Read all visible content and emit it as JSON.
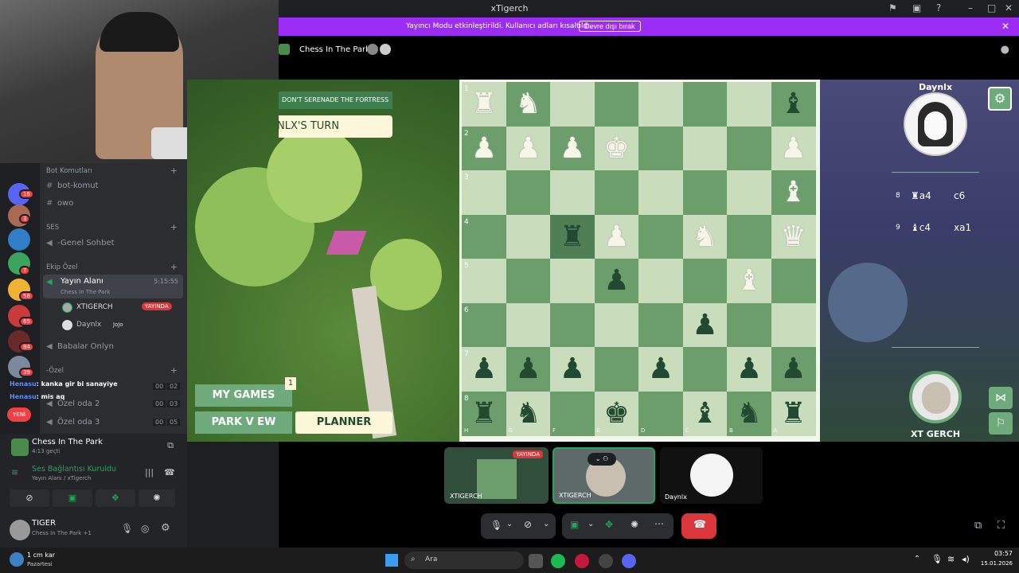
{
  "window": {
    "title": "xTigerch"
  },
  "banner": {
    "text": "Yayıncı Modu etkinleştirildi. Kullanıcı adları kısaltıldı.",
    "button": "Devre dışı bırak"
  },
  "activity": {
    "name": "Chess In The Park"
  },
  "channels": {
    "bot_category": "Bot Komutları",
    "bot_komut": "bot-komut",
    "owo": "owo",
    "ses_category": "SES",
    "genel": "-Genel Sohbet",
    "ekip_category": "Ekip Özel",
    "yayin_alani": "Yayın Alanı",
    "yayin_time": "5:15:55",
    "yayin_activity": "Chess In The Park",
    "user1": "XTIGERCH",
    "user1_badge": "YAYINDA",
    "user2": "Daynlx",
    "user2_status": "JoJo",
    "babalar": "Babalar Onlyn",
    "ozel_category": "-Özel",
    "chat1_user": "Henasu",
    "chat1_msg": ": kanka gir bi sanayiye",
    "chat2_user": "Henasu",
    "chat2_msg": ": mis aq",
    "ozel2": "Özel oda 2",
    "ozel2_a": "00",
    "ozel2_b": "03",
    "ozel3": "Özel oda 3",
    "ozel3_a": "00",
    "ozel3_b": "05",
    "ozel1_a": "00",
    "ozel1_b": "02",
    "yeni": "YENİ"
  },
  "guild_badges": [
    "16",
    "3",
    "7",
    "58",
    "65",
    "84",
    "39"
  ],
  "activity_panel": {
    "title": "Chess In The Park",
    "time": "4:13 geçti"
  },
  "voice_panel": {
    "status": "Ses Bağlantısı Kuruldu",
    "channel": "Yayın Alanı / xTigerch"
  },
  "user_panel": {
    "name": "TIGER",
    "activity": "Chess In The Park +1"
  },
  "game": {
    "banner": "DON'T SERENADE THE FORTRESS",
    "turn": "NLX'S TURN",
    "my_games": "MY GAMES",
    "my_games_count": "1",
    "park_view": "PARK V EW",
    "planner": "PLANNER",
    "ranks": [
      "1",
      "2",
      "3",
      "4",
      "5",
      "6",
      "7",
      "8"
    ],
    "files": [
      "H",
      "G",
      "F",
      "E",
      "D",
      "C",
      "B",
      "A"
    ],
    "opponent": "Daynlx",
    "player": "XT GERCH",
    "moves": [
      {
        "num": "8",
        "w": "♜a4",
        "b": "c6"
      },
      {
        "num": "9",
        "w": "♝c4",
        "b": "xa1"
      }
    ]
  },
  "call": {
    "tile1": "XTIGERCH",
    "tile1_badge": "YAYINDA",
    "tile2": "XTIGERCH",
    "tile3": "Daynlx"
  },
  "taskbar": {
    "weather": "1 cm kar",
    "weather_day": "Pazartesi",
    "search": "Ara",
    "time": "03:57",
    "date": "15.01.2026"
  }
}
